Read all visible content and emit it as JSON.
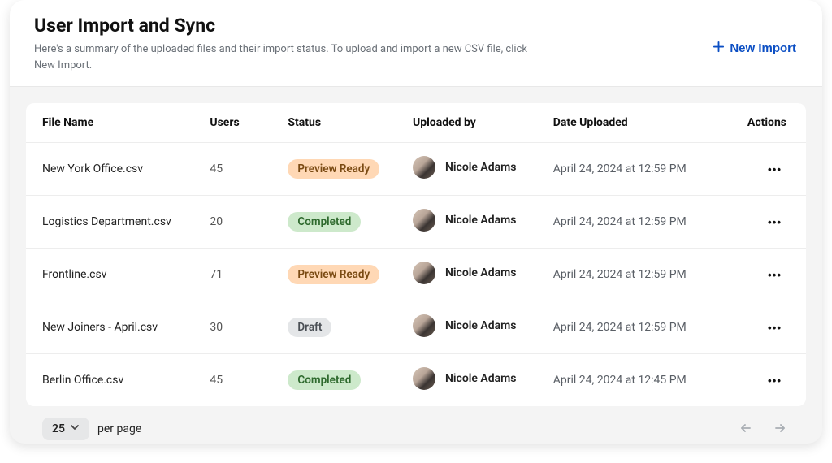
{
  "header": {
    "title": "User Import and Sync",
    "subtitle": "Here's a summary of the uploaded files and their import status. To upload and import a new CSV file, click New Import.",
    "new_import_label": "New Import"
  },
  "table": {
    "columns": {
      "file_name": "File Name",
      "users": "Users",
      "status": "Status",
      "uploaded_by": "Uploaded by",
      "date_uploaded": "Date Uploaded",
      "actions": "Actions"
    },
    "status_labels": {
      "preview_ready": "Preview Ready",
      "completed": "Completed",
      "draft": "Draft"
    },
    "rows": [
      {
        "file_name": "New York Office.csv",
        "users": "45",
        "status_key": "preview_ready",
        "uploaded_by": "Nicole Adams",
        "date_uploaded": "April 24, 2024 at 12:59 PM"
      },
      {
        "file_name": "Logistics Department.csv",
        "users": "20",
        "status_key": "completed",
        "uploaded_by": "Nicole Adams",
        "date_uploaded": "April 24, 2024 at 12:59 PM"
      },
      {
        "file_name": "Frontline.csv",
        "users": "71",
        "status_key": "preview_ready",
        "uploaded_by": "Nicole Adams",
        "date_uploaded": "April 24, 2024 at 12:59 PM"
      },
      {
        "file_name": "New Joiners - April.csv",
        "users": "30",
        "status_key": "draft",
        "uploaded_by": "Nicole Adams",
        "date_uploaded": "April 24, 2024 at 12:59 PM"
      },
      {
        "file_name": "Berlin Office.csv",
        "users": "45",
        "status_key": "completed",
        "uploaded_by": "Nicole Adams",
        "date_uploaded": "April 24, 2024 at 12:45 PM"
      }
    ]
  },
  "pagination": {
    "page_size": "25",
    "per_page_label": "per page"
  }
}
